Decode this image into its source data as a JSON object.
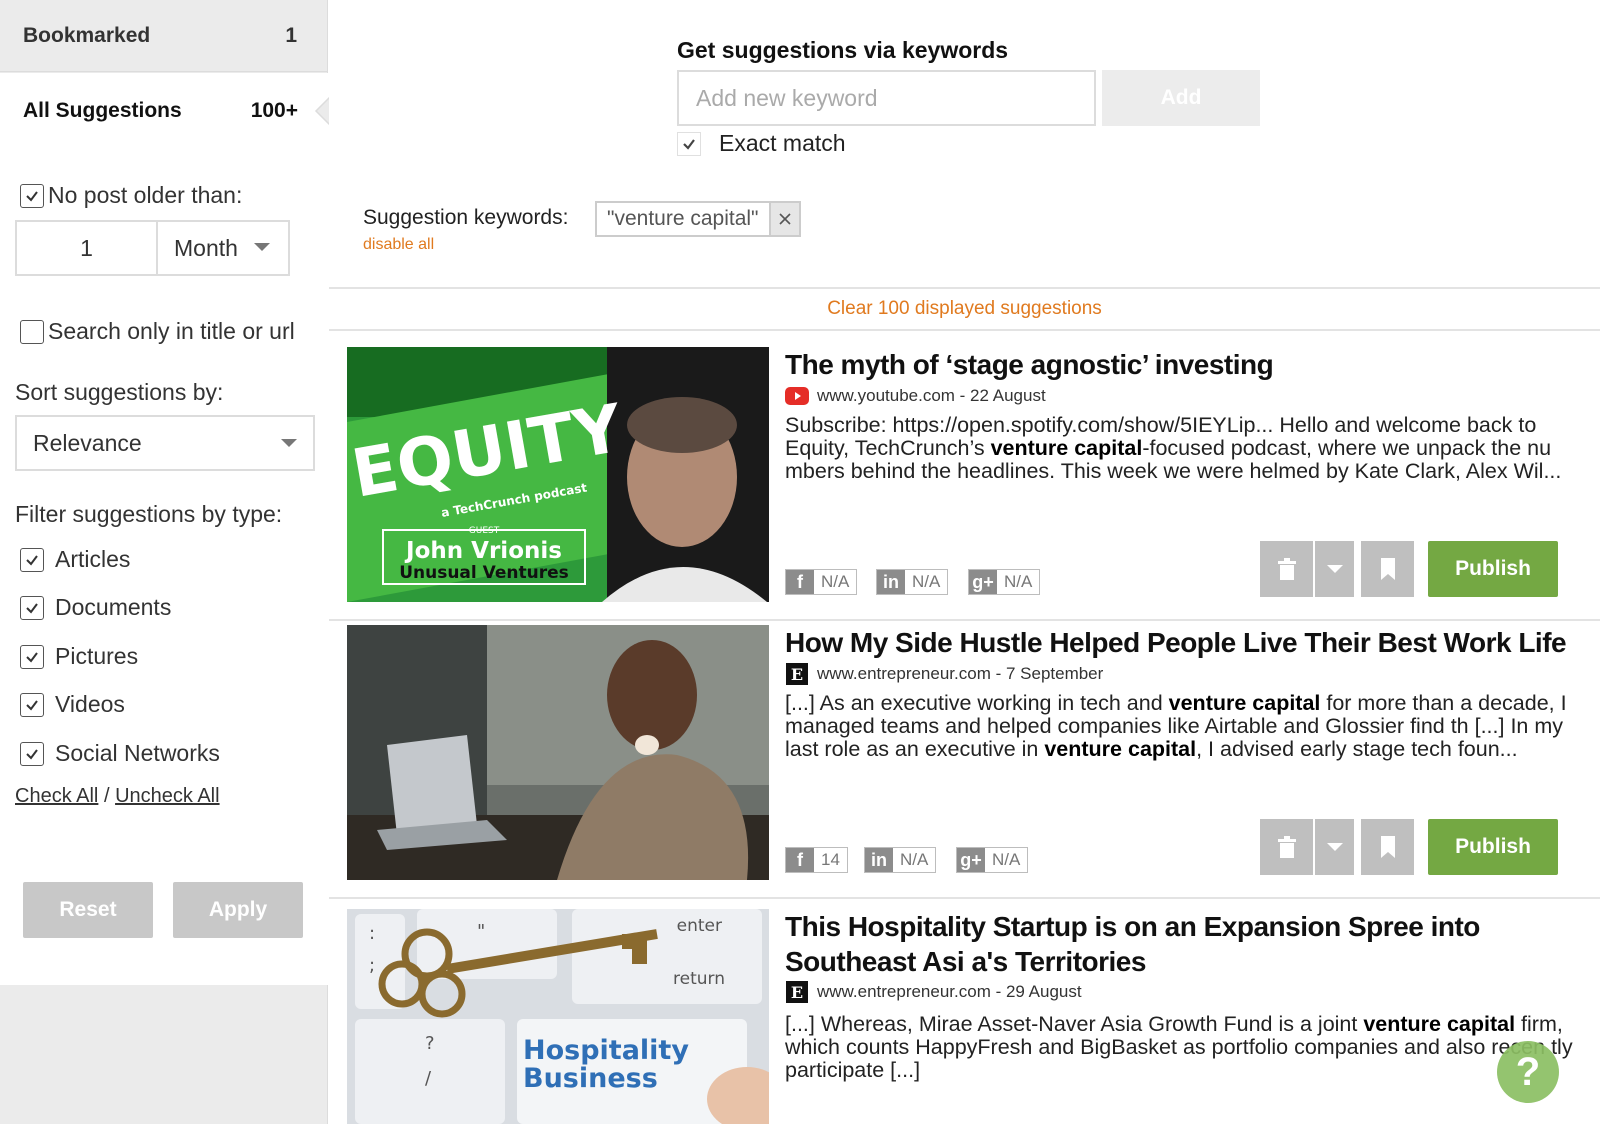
{
  "sidebar": {
    "bookmarked": {
      "label": "Bookmarked",
      "count": "1"
    },
    "all_suggestions": {
      "label": "All Suggestions",
      "count": "100+"
    },
    "age_filter": {
      "label": "No post older than:",
      "checked": true,
      "number": "1",
      "unit": "Month"
    },
    "title_url_filter": {
      "label": "Search only in title or url",
      "checked": false
    },
    "sort": {
      "label": "Sort suggestions by:",
      "value": "Relevance"
    },
    "type_filter": {
      "label": "Filter suggestions by type:",
      "types": [
        {
          "label": "Articles",
          "checked": true
        },
        {
          "label": "Documents",
          "checked": true
        },
        {
          "label": "Pictures",
          "checked": true
        },
        {
          "label": "Videos",
          "checked": true
        },
        {
          "label": "Social Networks",
          "checked": true
        }
      ],
      "check_all": "Check All",
      "separator": "/",
      "uncheck_all": "Uncheck All"
    },
    "reset_label": "Reset",
    "apply_label": "Apply"
  },
  "keywords": {
    "title": "Get suggestions via keywords",
    "placeholder": "Add new keyword",
    "add_label": "Add",
    "exact_match_label": "Exact match",
    "exact_match_checked": true,
    "suggestion_label": "Suggestion keywords:",
    "disable_all": "disable all",
    "chips": [
      "\"venture capital\""
    ]
  },
  "clear_label": "Clear 100 displayed suggestions",
  "cards": [
    {
      "title": "The myth of ‘stage agnostic’ investing",
      "source_icon": "youtube-icon",
      "source": "www.youtube.com - 22 August",
      "desc_parts": [
        {
          "text": "Subscribe: https://open.spotify.com/show/5IEYLip... Hello and welcome back to Equity, TechCrunch’s ",
          "bold": false
        },
        {
          "text": "venture capital",
          "bold": true
        },
        {
          "text": "-focused podcast, where we unpack the nu mbers behind the headlines. This week we were helmed by Kate Clark, Alex Wil...",
          "bold": false
        }
      ],
      "facebook": "N/A",
      "linkedin": "N/A",
      "googleplus": "N/A",
      "publish_label": "Publish",
      "thumb": {
        "brand": "EQUITY",
        "sub": "a TechCrunch podcast",
        "guest_label": "GUEST",
        "guest": "John Vrionis",
        "company": "Unusual Ventures"
      }
    },
    {
      "title": "How My Side Hustle Helped People Live Their Best Work Life",
      "source_icon": "entrepreneur-icon",
      "source": "www.entrepreneur.com - 7 September",
      "desc_parts": [
        {
          "text": "[...] As an executive working in tech and ",
          "bold": false
        },
        {
          "text": "venture capital",
          "bold": true
        },
        {
          "text": " for more than a decade, I managed teams and helped companies like Airtable and Glossier find th [...] In my last role as an executive in ",
          "bold": false
        },
        {
          "text": "venture capital",
          "bold": true
        },
        {
          "text": ", I advised early stage tech foun...",
          "bold": false
        }
      ],
      "facebook": "14",
      "linkedin": "N/A",
      "googleplus": "N/A",
      "publish_label": "Publish"
    },
    {
      "title": "This Hospitality Startup is on an Expansion Spree into Southeast Asi a's Territories",
      "source_icon": "entrepreneur-icon",
      "source": "www.entrepreneur.com - 29 August",
      "desc_parts": [
        {
          "text": "[...] Whereas, Mirae Asset-Naver Asia Growth Fund is a joint ",
          "bold": false
        },
        {
          "text": "venture capital",
          "bold": true
        },
        {
          "text": " firm, which counts HappyFresh and BigBasket as portfolio companies and also recen tly participate [...]",
          "bold": false
        }
      ],
      "thumb": {
        "key_top": "enter",
        "key_bottom": "return",
        "word1": "Hospitality",
        "word2": "Business",
        "key_left1": ":",
        "key_left2": ";",
        "key_quote": "\"",
        "key_q": "?",
        "key_slash": "/"
      }
    }
  ],
  "colors": {
    "accent_orange": "#e07a1f",
    "publish_green": "#74a843",
    "equity_green": "#3dab3a"
  },
  "icons": {
    "youtube": "youtube-icon",
    "entrepreneur": "entrepreneur-icon",
    "facebook": "f",
    "linkedin": "in",
    "googleplus": "g+",
    "help": "?"
  }
}
